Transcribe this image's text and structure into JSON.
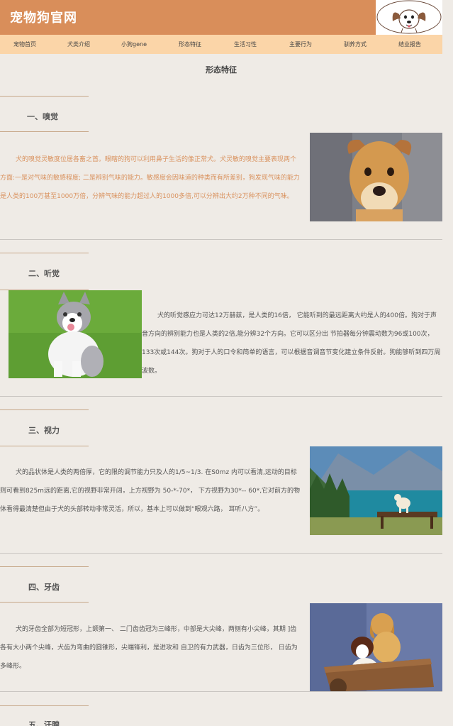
{
  "site": {
    "title": "宠物狗官网"
  },
  "nav": [
    "宠物首页",
    "犬类介绍",
    "小狗gene",
    "形态特征",
    "生活习性",
    "主要行为",
    "驯养方式",
    "结业报告"
  ],
  "page_title": "形态特征",
  "sections": [
    {
      "heading": "一、嗅觉",
      "text": "犬的嗅觉灵敏度位居各畜之首。眼瞎的狗可以利用鼻子生活的像正常犬。犬灵敏的嗅觉主要表现两个方面:一是对气味的敏感程度; 二是辨别气味的能力。敏感度会因味道的种类而有所差别，狗发现气味的能力是人类的100万甚至1000万倍，分辨气味的能力超过人的1000多倍,可以分辨出大约2万种不同的气味。",
      "image": "short-haired-dog-photo"
    },
    {
      "heading": "二、听觉",
      "text": "犬的听觉感应力可达12万赫兹，是人类的16倍， 它能听到的最远距离大约是人的400倍。狗对于声音方向的辨别能力也是人类的2倍,能分辨32个方向。它可以区分出 节拍器每分钟震动数为96或100次，133次或144次。狗对于人的口令和简单的语言，可以根据音调音节变化建立条件反射。狗能够听到四万周波数。",
      "image": "husky-photo"
    },
    {
      "heading": "三、视力",
      "text": "犬的品状体是人类的两倍厚，它的限的调节能力只及人的1/5~1/3. 在S0mz 内可以看清,运动的目标则可看到825m远的距离,它的视野非常开阔，上方视野为 50-*-70*， 下方视野为30*-- 60*,它对前方的物体看得最清楚但由于犬的头部转动非常灵活，所以，基本上可以做到“眼观六路， 耳听八方”。",
      "image": "lake-dog-photo"
    },
    {
      "heading": "四、牙齿",
      "text": "犬的牙齿全部为短冠形，上颌第一、 二门齿齿冠为三峰形，中部是大尖峰，两侧有小尖峰，其期 ]齿各有大小两个尖峰，犬齿为弯曲的圆锥形，尖端锋利，是进攻和 自卫的有力武器，日齿为三位形， 日齿为多峰形。",
      "image": "two-puppies-photo"
    },
    {
      "heading": "五、汗腺"
    }
  ],
  "colors": {
    "header": "#d98e5a",
    "nav": "#fbd5a8",
    "background": "#efebe6",
    "accent_text": "#d9925e"
  }
}
